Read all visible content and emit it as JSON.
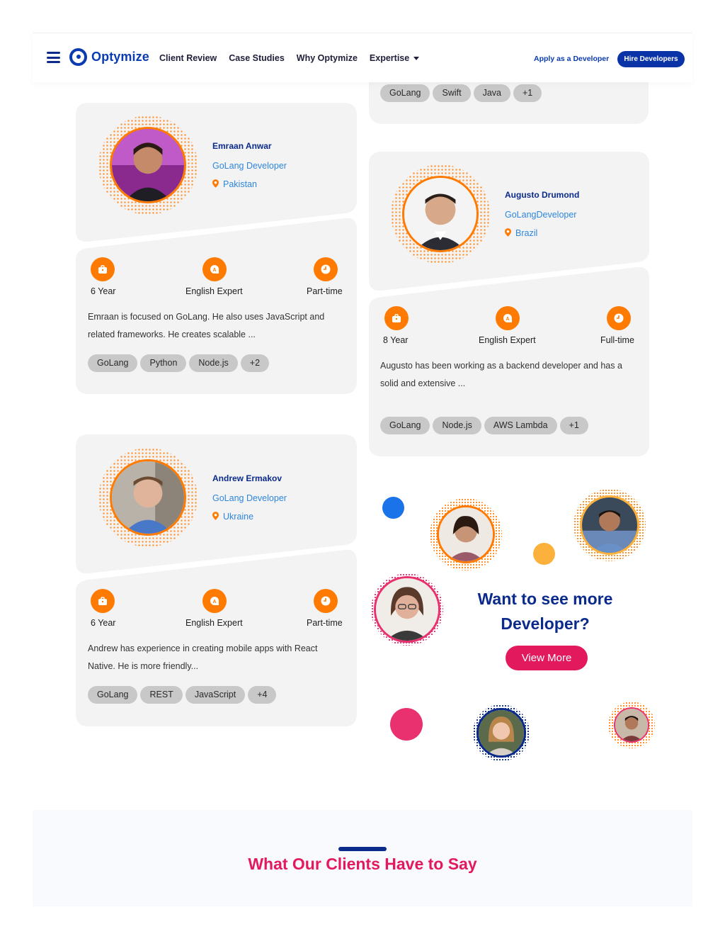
{
  "nav": {
    "brand": "Optymize",
    "menu": [
      "Client Review",
      "Case Studies",
      "Why Optymize",
      "Expertise"
    ],
    "apply": "Apply as a Developer",
    "hire": "Hire Developers"
  },
  "partial_card": {
    "tags": [
      "GoLang",
      "Swift",
      "Java",
      "+1"
    ]
  },
  "developers": [
    {
      "name": "Emraan Anwar",
      "role": "GoLang Developer",
      "location": "Pakistan",
      "experience": "6 Year",
      "english": "English Expert",
      "availability": "Part-time",
      "description": "Emraan is focused on GoLang. He also uses JavaScript and related frameworks. He creates scalable ...",
      "tags": [
        "GoLang",
        "Python",
        "Node.js",
        "+2"
      ]
    },
    {
      "name": "Augusto Drumond",
      "role": "GoLangDeveloper",
      "location": "Brazil",
      "experience": "8 Year",
      "english": "English Expert",
      "availability": "Full-time",
      "description": "Augusto has been working as a backend developer and has a solid and extensive ...",
      "tags": [
        "GoLang",
        "Node.js",
        "AWS Lambda",
        "+1"
      ]
    },
    {
      "name": "Andrew Ermakov",
      "role": "GoLang Developer",
      "location": "Ukraine",
      "experience": "6 Year",
      "english": "English Expert",
      "availability": "Part-time",
      "description": "Andrew has experience in creating mobile apps with React Native. He is more friendly...",
      "tags": [
        "GoLang",
        "REST",
        "JavaScript",
        "+4"
      ]
    }
  ],
  "more": {
    "heading_line1": "Want to see more",
    "heading_line2": "Developer?",
    "button": "View More"
  },
  "clients": {
    "heading": "What Our Clients Have to Say"
  },
  "colors": {
    "brand_blue": "#0a2a8c",
    "accent_orange": "#ff7a00",
    "accent_pink": "#e3195d",
    "link_blue": "#2e86de"
  }
}
